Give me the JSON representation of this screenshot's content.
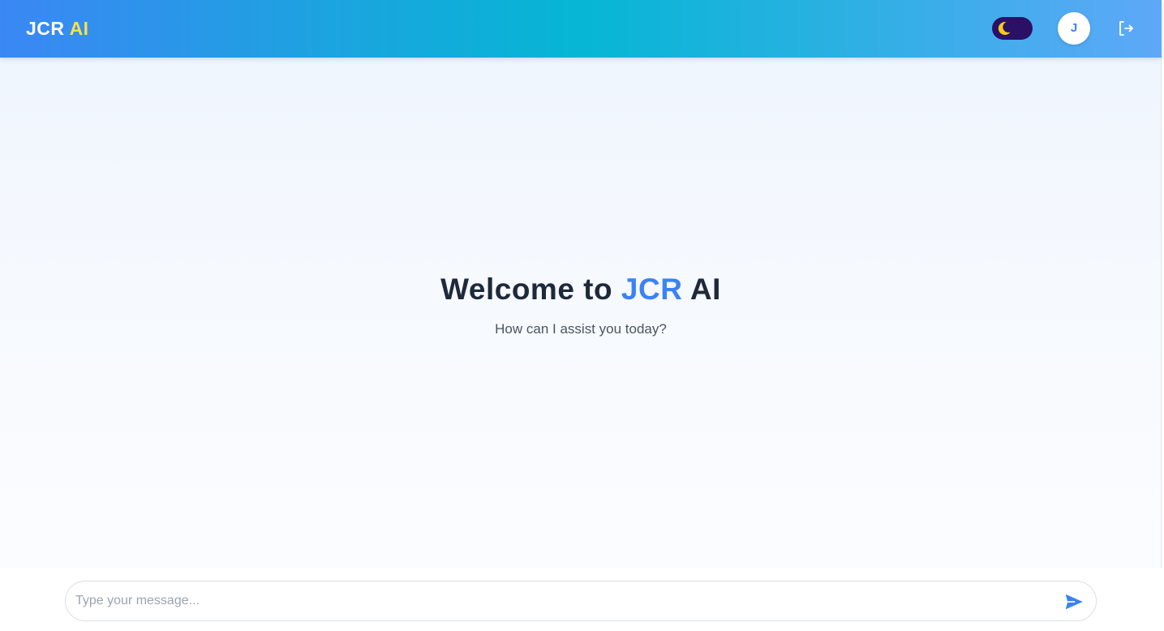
{
  "header": {
    "brand_primary": "JCR",
    "brand_accent": "AI",
    "theme_toggle_icon": "moon-icon",
    "user_avatar_initial": "J",
    "logout_icon": "logout-icon"
  },
  "welcome": {
    "title_prefix": "Welcome to",
    "title_brand": "JCR",
    "title_suffix": "AI",
    "subtitle": "How can I assist you today?"
  },
  "composer": {
    "placeholder": "Type your message...",
    "value": "",
    "send_icon": "send-icon"
  },
  "colors": {
    "accent": "#3b82f6",
    "brand_yellow": "#fde047",
    "toggle_bg": "#2a1166",
    "moon": "#facc15",
    "heading": "#1e293b"
  }
}
